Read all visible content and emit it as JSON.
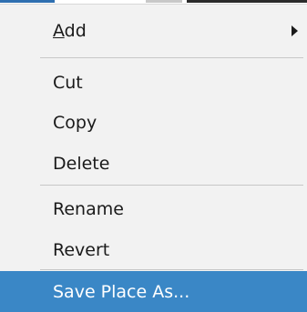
{
  "context_menu": {
    "items": [
      {
        "label_accel": "A",
        "label_rest": "dd",
        "has_submenu": true,
        "submenu_icon": "submenu-arrow-icon"
      },
      {
        "label": "Cut"
      },
      {
        "label": "Copy"
      },
      {
        "label": "Delete"
      },
      {
        "label": "Rename"
      },
      {
        "label": "Revert"
      },
      {
        "label": "Save Place As..."
      }
    ],
    "highlight_color": "#3a87c6",
    "background_color": "#f2f2f2"
  }
}
